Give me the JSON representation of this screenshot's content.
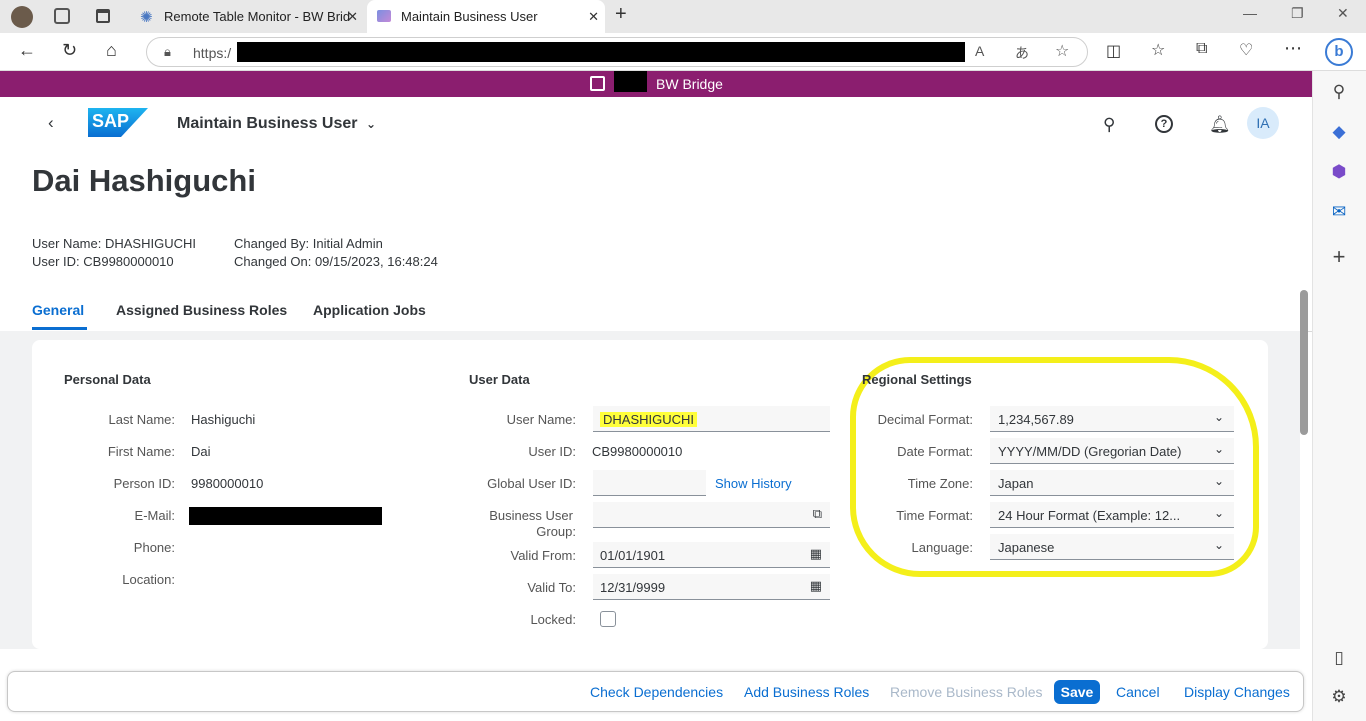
{
  "browser": {
    "tabs": [
      {
        "title": "Remote Table Monitor - BW Brid",
        "active": false
      },
      {
        "title": "Maintain Business User",
        "active": true
      }
    ],
    "url_prefix": "https:/"
  },
  "sap": {
    "banner": "BW Bridge",
    "logo": "SAP",
    "app_title": "Maintain Business User",
    "avatar_initials": "IA",
    "accent_color": "#0a6ed1",
    "banner_color": "#8b1e6f"
  },
  "header": {
    "name": "Dai Hashiguchi",
    "user_name_line": "User Name: DHASHIGUCHI",
    "user_id_line": "User ID: CB9980000010",
    "changed_by_line": "Changed By: Initial Admin",
    "changed_on_line": "Changed On: 09/15/2023, 16:48:24"
  },
  "tabs": [
    "General",
    "Assigned Business Roles",
    "Application Jobs"
  ],
  "personal": {
    "title": "Personal Data",
    "last_name_label": "Last Name:",
    "last_name": "Hashiguchi",
    "first_name_label": "First Name:",
    "first_name": "Dai",
    "person_id_label": "Person ID:",
    "person_id": "9980000010",
    "email_label": "E-Mail:",
    "phone_label": "Phone:",
    "location_label": "Location:"
  },
  "userdata": {
    "title": "User Data",
    "user_name_label": "User Name:",
    "user_name": "DHASHIGUCHI",
    "user_id_label": "User ID:",
    "user_id": "CB9980000010",
    "global_user_id_label": "Global User ID:",
    "show_history": "Show History",
    "group_label_1": "Business User",
    "group_label_2": "Group:",
    "valid_from_label": "Valid From:",
    "valid_from": "01/01/1901",
    "valid_to_label": "Valid To:",
    "valid_to": "12/31/9999",
    "locked_label": "Locked:"
  },
  "regional": {
    "title": "Regional Settings",
    "decimal_label": "Decimal Format:",
    "decimal": "1,234,567.89",
    "date_label": "Date Format:",
    "date": "YYYY/MM/DD (Gregorian Date)",
    "tz_label": "Time Zone:",
    "tz": "Japan",
    "time_label": "Time Format:",
    "time": "24 Hour Format (Example: 12...",
    "lang_label": "Language:",
    "lang": "Japanese"
  },
  "footer": {
    "check": "Check Dependencies",
    "add": "Add Business Roles",
    "remove": "Remove Business Roles",
    "save": "Save",
    "cancel": "Cancel",
    "display": "Display Changes"
  }
}
